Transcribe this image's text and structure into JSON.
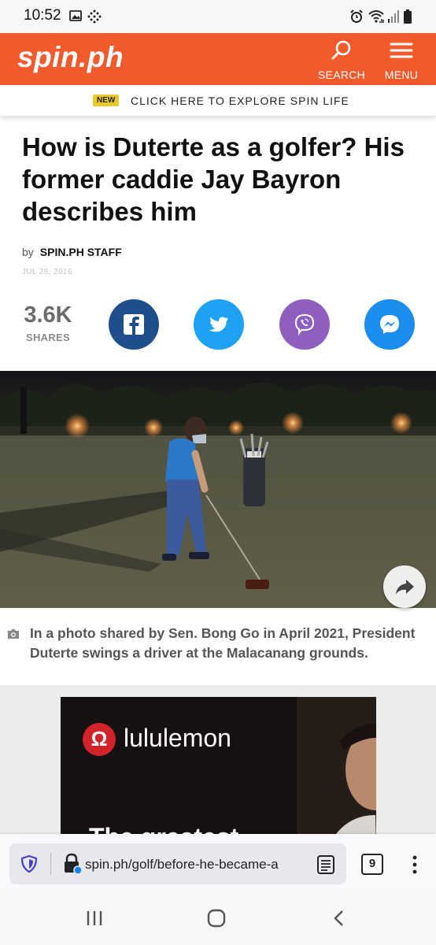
{
  "status_bar": {
    "time": "10:52",
    "icons": [
      "gallery-icon",
      "dots-grid-icon",
      "alarm-icon",
      "wifi-icon",
      "signal-icon",
      "battery-icon"
    ]
  },
  "header": {
    "logo": "spin.ph",
    "search_label": "SEARCH",
    "menu_label": "MENU",
    "background_color": "#f15a2b"
  },
  "promo": {
    "badge": "NEW",
    "text": "CLICK HERE TO EXPLORE SPIN LIFE",
    "badge_color": "#e8c92e"
  },
  "article": {
    "title": "How is Duterte as a golfer? His former caddie Jay Bayron describes him",
    "by_label": "by",
    "author": "SPIN.PH STAFF",
    "date": "JUL 28, 2016",
    "share_count": "3.6K",
    "share_label": "SHARES",
    "share_buttons": [
      {
        "name": "facebook-icon",
        "color": "#1f4e8c"
      },
      {
        "name": "twitter-icon",
        "color": "#1da1f2"
      },
      {
        "name": "viber-icon",
        "color": "#8e5fc1"
      },
      {
        "name": "messenger-icon",
        "color": "#1b8cf0"
      }
    ],
    "caption": "In a photo shared by Sen. Bong Go in April 2021, President Duterte swings a driver at the Malacanang grounds."
  },
  "ad": {
    "brand": "lululemon",
    "headline": "The greatest"
  },
  "browser": {
    "url": "spin.ph/golf/before-he-became-a",
    "tab_count": "9"
  }
}
